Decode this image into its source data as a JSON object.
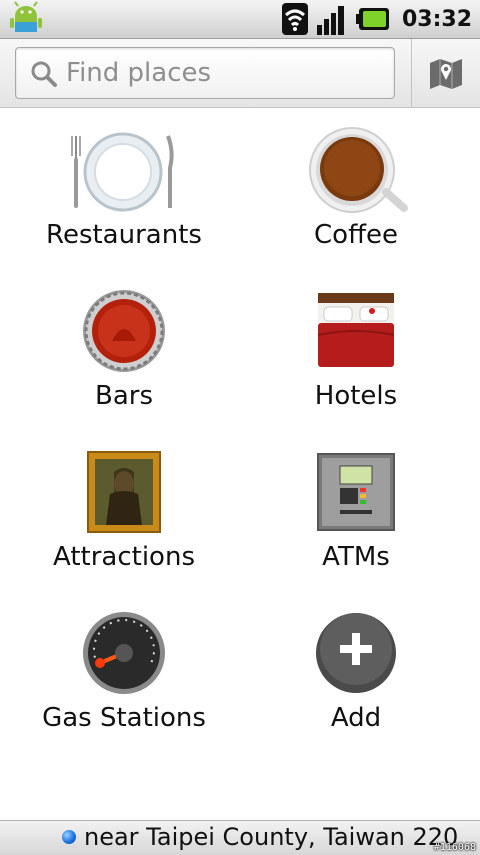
{
  "status_bar": {
    "time": "03:32"
  },
  "search": {
    "placeholder": "Find places"
  },
  "categories": [
    {
      "label": "Restaurants",
      "icon": "restaurant-plate-icon"
    },
    {
      "label": "Coffee",
      "icon": "coffee-cup-icon"
    },
    {
      "label": "Bars",
      "icon": "bottle-cap-icon"
    },
    {
      "label": "Hotels",
      "icon": "hotel-bed-icon"
    },
    {
      "label": "Attractions",
      "icon": "mona-lisa-frame-icon"
    },
    {
      "label": "ATMs",
      "icon": "atm-machine-icon"
    },
    {
      "label": "Gas Stations",
      "icon": "fuel-gauge-icon"
    },
    {
      "label": "Add",
      "icon": "add-plus-icon"
    }
  ],
  "footer": {
    "location_text": "near Taipei County, Taiwan 220",
    "watermark": "#116068"
  }
}
